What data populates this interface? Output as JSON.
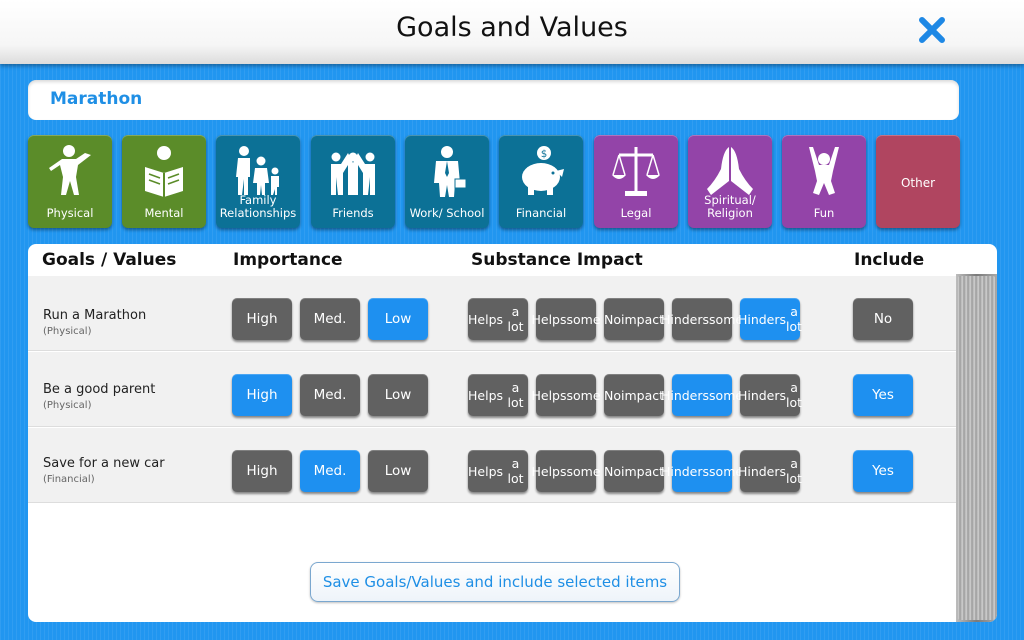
{
  "header": {
    "title": "Goals and Values",
    "close_icon": "close-icon"
  },
  "goal_name": "Marathon",
  "categories": [
    {
      "label": "Physical",
      "icon": "physical-icon",
      "color": "#5b8c29"
    },
    {
      "label": "Mental",
      "icon": "mental-icon",
      "color": "#5b8c29"
    },
    {
      "label": "Family Relationships",
      "icon": "family-icon",
      "color": "#0c7196"
    },
    {
      "label": "Friends",
      "icon": "friends-icon",
      "color": "#0c7196"
    },
    {
      "label": "Work/ School",
      "icon": "work-icon",
      "color": "#0c7196"
    },
    {
      "label": "Financial",
      "icon": "piggy-bank-icon",
      "color": "#0c7196"
    },
    {
      "label": "Legal",
      "icon": "scales-icon",
      "color": "#9344a8"
    },
    {
      "label": "Spiritual/ Religion",
      "icon": "praying-hands-icon",
      "color": "#9344a8"
    },
    {
      "label": "Fun",
      "icon": "celebrate-icon",
      "color": "#9344a8"
    },
    {
      "label": "Other",
      "icon": "",
      "color": "#b04560"
    }
  ],
  "table": {
    "headers": {
      "goals": "Goals / Values",
      "importance": "Importance",
      "impact": "Substance Impact",
      "include": "Include"
    },
    "importance_options": [
      "High",
      "Med.",
      "Low"
    ],
    "impact_options": [
      [
        "Helps",
        "a lot"
      ],
      [
        "Helps",
        "some"
      ],
      [
        "No",
        "impact"
      ],
      [
        "Hinders",
        "some"
      ],
      [
        "Hinders",
        "a lot"
      ]
    ],
    "rows": [
      {
        "name": "Run a Marathon",
        "category": "(Physical)",
        "importance": "Low",
        "impact": "Hinders a lot",
        "include": "No"
      },
      {
        "name": "Be a good parent",
        "category": "(Physical)",
        "importance": "High",
        "impact": "Hinders some",
        "include": "Yes"
      },
      {
        "name": "Save for a new car",
        "category": "(Financial)",
        "importance": "Med.",
        "impact": "Hinders some",
        "include": "Yes"
      }
    ]
  },
  "save_button": "Save Goals/Values and include selected items",
  "colors": {
    "accent": "#1e90f0",
    "button_off": "#616161"
  }
}
